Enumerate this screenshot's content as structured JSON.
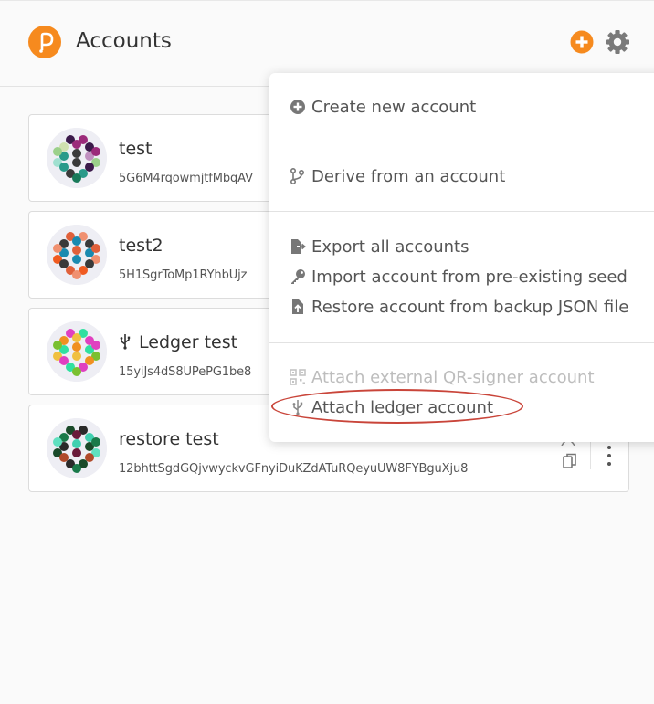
{
  "header": {
    "title": "Accounts",
    "accent_color": "#f68a1e",
    "logo_icon": "polkadot-logo-icon",
    "add_icon": "plus-circle-icon",
    "settings_icon": "gear-icon"
  },
  "accounts": [
    {
      "name": "test",
      "address": "5G6M4rqowmjtfMbqAV",
      "is_ledger": false
    },
    {
      "name": "test2",
      "address": "5H1SgrToMp1RYhbUjz",
      "is_ledger": false
    },
    {
      "name": "Ledger test",
      "address": "15yiJs4dS8UPePG1be8",
      "is_ledger": true
    },
    {
      "name": "restore test",
      "address": "12bhttSgdGQjvwyckvGFnyiDuKZdATuRQeyuUW8FYBguXju8",
      "is_ledger": false
    }
  ],
  "menu": {
    "items": [
      {
        "label": "Create new account",
        "icon": "plus-circle-icon",
        "enabled": true
      },
      {
        "label": "Derive from an account",
        "icon": "code-branch-icon",
        "enabled": true
      },
      {
        "label": "Export all accounts",
        "icon": "file-export-icon",
        "enabled": true
      },
      {
        "label": "Import account from pre-existing seed",
        "icon": "key-icon",
        "enabled": true
      },
      {
        "label": "Restore account from backup JSON file",
        "icon": "file-upload-icon",
        "enabled": true
      },
      {
        "label": "Attach external QR-signer account",
        "icon": "qrcode-icon",
        "enabled": false
      },
      {
        "label": "Attach ledger account",
        "icon": "usb-icon",
        "enabled": true
      }
    ],
    "highlighted_item": "Attach ledger account",
    "highlight_color": "#c9453a"
  }
}
